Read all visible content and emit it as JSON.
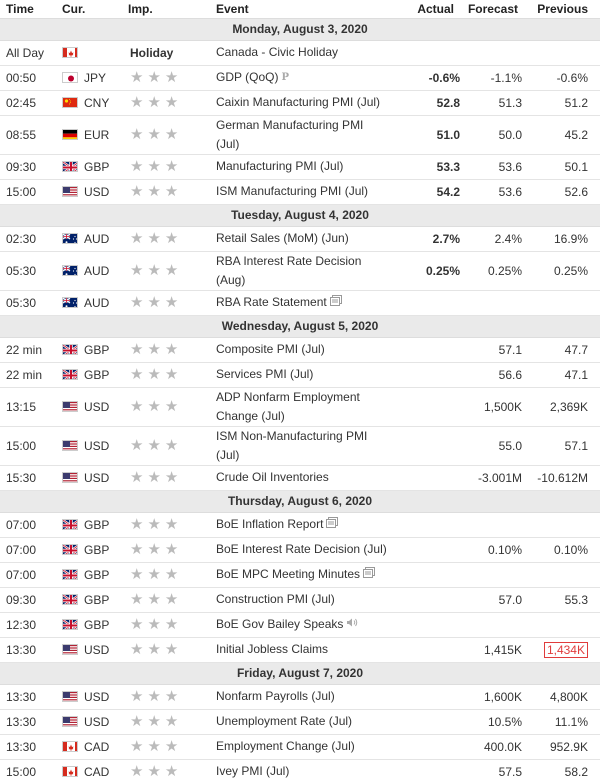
{
  "header": {
    "time": "Time",
    "cur": "Cur.",
    "imp": "Imp.",
    "event": "Event",
    "actual": "Actual",
    "forecast": "Forecast",
    "previous": "Previous"
  },
  "colors": {
    "positive": "#2ca82c",
    "negative": "#e03c3c",
    "star_inactive": "#bbbbbb",
    "day_header_bg": "#eaeaea"
  },
  "days": [
    {
      "label": "Monday, August 3, 2020",
      "events": [
        {
          "time": "All Day",
          "flag": "CA",
          "currency": "",
          "importance": "Holiday",
          "event": "Canada - Civic Holiday",
          "actual": "",
          "actual_color": "",
          "forecast": "",
          "previous": "",
          "icon": ""
        },
        {
          "time": "00:50",
          "flag": "JP",
          "currency": "JPY",
          "importance": "stars",
          "event": "GDP (QoQ)",
          "icon": "preliminary-icon",
          "icon_text": "P",
          "actual": "-0.6%",
          "actual_color": "green",
          "forecast": "-1.1%",
          "previous": "-0.6%"
        },
        {
          "time": "02:45",
          "flag": "CN",
          "currency": "CNY",
          "importance": "stars",
          "event": "Caixin Manufacturing PMI (Jul)",
          "actual": "52.8",
          "actual_color": "green",
          "forecast": "51.3",
          "previous": "51.2",
          "icon": ""
        },
        {
          "time": "08:55",
          "flag": "DE",
          "currency": "EUR",
          "importance": "stars",
          "event": "German Manufacturing PMI (Jul)",
          "actual": "51.0",
          "actual_color": "green",
          "forecast": "50.0",
          "previous": "45.2",
          "icon": ""
        },
        {
          "time": "09:30",
          "flag": "GB",
          "currency": "GBP",
          "importance": "stars",
          "event": "Manufacturing PMI (Jul)",
          "actual": "53.3",
          "actual_color": "red",
          "forecast": "53.6",
          "previous": "50.1",
          "icon": ""
        },
        {
          "time": "15:00",
          "flag": "US",
          "currency": "USD",
          "importance": "stars",
          "event": "ISM Manufacturing PMI (Jul)",
          "actual": "54.2",
          "actual_color": "green",
          "forecast": "53.6",
          "previous": "52.6",
          "icon": ""
        }
      ]
    },
    {
      "label": "Tuesday, August 4, 2020",
      "events": [
        {
          "time": "02:30",
          "flag": "AU",
          "currency": "AUD",
          "importance": "stars",
          "event": "Retail Sales (MoM) (Jun)",
          "actual": "2.7%",
          "actual_color": "green",
          "forecast": "2.4%",
          "previous": "16.9%",
          "icon": ""
        },
        {
          "time": "05:30",
          "flag": "AU",
          "currency": "AUD",
          "importance": "stars",
          "event": "RBA Interest Rate Decision (Aug)",
          "actual": "0.25%",
          "actual_color": "bold",
          "forecast": "0.25%",
          "previous": "0.25%",
          "icon": "",
          "tall": true
        },
        {
          "time": "05:30",
          "flag": "AU",
          "currency": "AUD",
          "importance": "stars",
          "event": "RBA Rate Statement",
          "actual": "",
          "actual_color": "",
          "forecast": "",
          "previous": "",
          "icon": "report-icon"
        }
      ]
    },
    {
      "label": "Wednesday, August 5, 2020",
      "events": [
        {
          "time": "22 min",
          "flag": "GB",
          "currency": "GBP",
          "importance": "stars",
          "event": "Composite PMI (Jul)",
          "actual": "",
          "actual_color": "",
          "forecast": "57.1",
          "previous": "47.7",
          "icon": ""
        },
        {
          "time": "22 min",
          "flag": "GB",
          "currency": "GBP",
          "importance": "stars",
          "event": "Services PMI (Jul)",
          "actual": "",
          "actual_color": "",
          "forecast": "56.6",
          "previous": "47.1",
          "icon": ""
        },
        {
          "time": "13:15",
          "flag": "US",
          "currency": "USD",
          "importance": "stars",
          "event": "ADP Nonfarm Employment Change (Jul)",
          "actual": "",
          "actual_color": "",
          "forecast": "1,500K",
          "previous": "2,369K",
          "icon": "",
          "tall": true
        },
        {
          "time": "15:00",
          "flag": "US",
          "currency": "USD",
          "importance": "stars",
          "event": "ISM Non-Manufacturing PMI (Jul)",
          "actual": "",
          "actual_color": "",
          "forecast": "55.0",
          "previous": "57.1",
          "icon": "",
          "tall": true
        },
        {
          "time": "15:30",
          "flag": "US",
          "currency": "USD",
          "importance": "stars",
          "event": "Crude Oil Inventories",
          "actual": "",
          "actual_color": "",
          "forecast": "-3.001M",
          "previous": "-10.612M",
          "icon": ""
        }
      ]
    },
    {
      "label": "Thursday, August 6, 2020",
      "events": [
        {
          "time": "07:00",
          "flag": "GB",
          "currency": "GBP",
          "importance": "stars",
          "event": "BoE Inflation Report",
          "actual": "",
          "actual_color": "",
          "forecast": "",
          "previous": "",
          "icon": "report-icon"
        },
        {
          "time": "07:00",
          "flag": "GB",
          "currency": "GBP",
          "importance": "stars",
          "event": "BoE Interest Rate Decision (Jul)",
          "actual": "",
          "actual_color": "",
          "forecast": "0.10%",
          "previous": "0.10%",
          "icon": ""
        },
        {
          "time": "07:00",
          "flag": "GB",
          "currency": "GBP",
          "importance": "stars",
          "event": "BoE MPC Meeting Minutes",
          "actual": "",
          "actual_color": "",
          "forecast": "",
          "previous": "",
          "icon": "report-icon"
        },
        {
          "time": "09:30",
          "flag": "GB",
          "currency": "GBP",
          "importance": "stars",
          "event": "Construction PMI (Jul)",
          "actual": "",
          "actual_color": "",
          "forecast": "57.0",
          "previous": "55.3",
          "icon": ""
        },
        {
          "time": "12:30",
          "flag": "GB",
          "currency": "GBP",
          "importance": "stars",
          "event": "BoE Gov Bailey Speaks",
          "actual": "",
          "actual_color": "",
          "forecast": "",
          "previous": "",
          "icon": "speaker-icon"
        },
        {
          "time": "13:30",
          "flag": "US",
          "currency": "USD",
          "importance": "stars",
          "event": "Initial Jobless Claims",
          "actual": "",
          "actual_color": "",
          "forecast": "1,415K",
          "previous": "1,434K",
          "previous_flag": "revised",
          "icon": ""
        }
      ]
    },
    {
      "label": "Friday, August 7, 2020",
      "events": [
        {
          "time": "13:30",
          "flag": "US",
          "currency": "USD",
          "importance": "stars",
          "event": "Nonfarm Payrolls (Jul)",
          "actual": "",
          "actual_color": "",
          "forecast": "1,600K",
          "previous": "4,800K",
          "icon": ""
        },
        {
          "time": "13:30",
          "flag": "US",
          "currency": "USD",
          "importance": "stars",
          "event": "Unemployment Rate (Jul)",
          "actual": "",
          "actual_color": "",
          "forecast": "10.5%",
          "previous": "11.1%",
          "icon": ""
        },
        {
          "time": "13:30",
          "flag": "CA",
          "currency": "CAD",
          "importance": "stars",
          "event": "Employment Change (Jul)",
          "actual": "",
          "actual_color": "",
          "forecast": "400.0K",
          "previous": "952.9K",
          "icon": ""
        },
        {
          "time": "15:00",
          "flag": "CA",
          "currency": "CAD",
          "importance": "stars",
          "event": "Ivey PMI (Jul)",
          "actual": "",
          "actual_color": "",
          "forecast": "57.5",
          "previous": "58.2",
          "icon": ""
        }
      ]
    }
  ]
}
